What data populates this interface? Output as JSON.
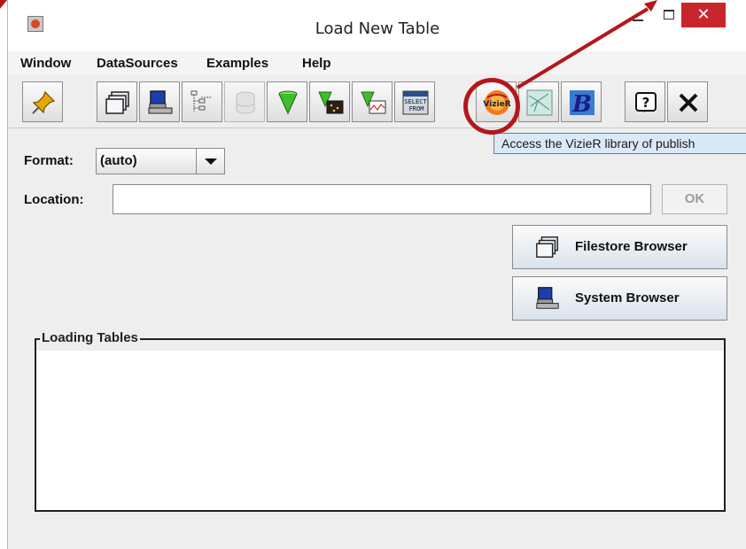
{
  "window": {
    "title": "Load New Table",
    "controls": {
      "minimize": "—",
      "maximize": "☐",
      "close": "✕"
    }
  },
  "menu": {
    "items": [
      {
        "label": "Window"
      },
      {
        "label": "DataSources"
      },
      {
        "label": "Examples"
      },
      {
        "label": "Help"
      }
    ]
  },
  "toolbar": {
    "buttons": [
      {
        "icon": "pin-icon"
      },
      {
        "icon": "filestore-icon"
      },
      {
        "icon": "system-computer-icon"
      },
      {
        "icon": "tree-hierarchy-icon"
      },
      {
        "icon": "database-icon",
        "disabled": true
      },
      {
        "icon": "green-cone-icon"
      },
      {
        "icon": "cone-table-icon"
      },
      {
        "icon": "cone-plot-icon"
      },
      {
        "icon": "select-from-icon"
      },
      {
        "icon": "vizier-icon"
      },
      {
        "icon": "network-map-icon"
      },
      {
        "icon": "b-letter-icon"
      },
      {
        "icon": "help-icon"
      },
      {
        "icon": "close-x-icon"
      }
    ]
  },
  "tooltip": {
    "text": "Access the VizieR library of publish"
  },
  "format": {
    "label": "Format:",
    "value": "(auto)"
  },
  "location": {
    "label": "Location:",
    "value": "",
    "ok_label": "OK"
  },
  "browsers": {
    "filestore_label": "Filestore Browser",
    "system_label": "System Browser"
  },
  "loading": {
    "title": "Loading Tables"
  },
  "colors": {
    "highlight": "#b5161c",
    "tooltip_bg": "#d9e9f7",
    "close_bg": "#c8262c"
  }
}
